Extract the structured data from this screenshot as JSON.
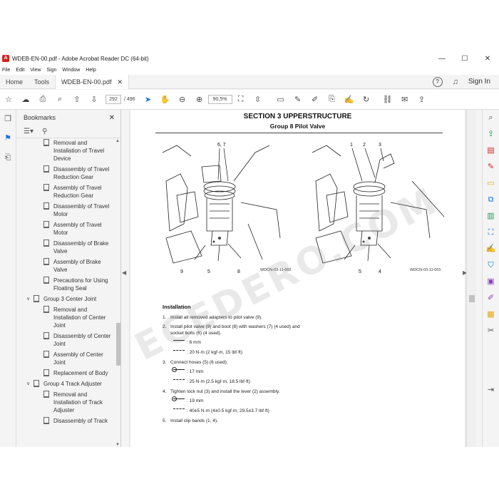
{
  "window": {
    "title": "WDEB-EN-00.pdf - Adobe Acrobat Reader DC (64-bit)",
    "controls": [
      "—",
      "☐",
      "✕"
    ]
  },
  "menu": [
    "File",
    "Edit",
    "View",
    "Sign",
    "Window",
    "Help"
  ],
  "tabs": {
    "home": "Home",
    "tools": "Tools",
    "document": "WDEB-EN-00.pdf",
    "close": "✕",
    "help": "?",
    "signin": "Sign In"
  },
  "toolbar": {
    "current_page": "292",
    "total_pages": "/ 496",
    "zoom": "90,5%"
  },
  "bookmarks": {
    "title": "Bookmarks",
    "items": [
      {
        "label": "Removal and Installation of Travel Device",
        "level": "child"
      },
      {
        "label": "Disassembly of Travel Reduction Gear",
        "level": "child"
      },
      {
        "label": "Assembly of Travel Reduction Gear",
        "level": "child"
      },
      {
        "label": "Disassembly of Travel Motor",
        "level": "child"
      },
      {
        "label": "Assembly of Travel Motor",
        "level": "child"
      },
      {
        "label": "Disassembly of Brake Valve",
        "level": "child"
      },
      {
        "label": "Assembly of Brake Valve",
        "level": "child"
      },
      {
        "label": "Precautions for Using Floating Seal",
        "level": "child"
      },
      {
        "label": "Group 3 Center Joint",
        "level": "group"
      },
      {
        "label": "Removal and Installation of Center Joint",
        "level": "child"
      },
      {
        "label": "Disassembly of Center Joint",
        "level": "child"
      },
      {
        "label": "Assembly of Center Joint",
        "level": "child"
      },
      {
        "label": "Replacement of Body",
        "level": "child"
      },
      {
        "label": "Group 4 Track Adjuster",
        "level": "group"
      },
      {
        "label": "Removal and Installation of Track Adjuster",
        "level": "child"
      },
      {
        "label": "Disassembly of Track",
        "level": "child"
      }
    ]
  },
  "document": {
    "section_title": "SECTION 3 UPPERSTRUCTURE",
    "group_title": "Group 8 Pilot Valve",
    "watermark": "ECEDERO.COM",
    "fig_left": {
      "caption": "WDCN-03-11-002",
      "callouts": [
        "6, 7",
        "9",
        "5",
        "8"
      ]
    },
    "fig_right": {
      "caption": "WDCN-03-11-001",
      "callouts": [
        "1",
        "2",
        "3",
        "5",
        "4"
      ]
    },
    "installation_heading": "Installation",
    "steps": [
      {
        "num": "1.",
        "text": "Install all removed adapters to pilot valve (9).",
        "specs": []
      },
      {
        "num": "2.",
        "text": "Install pilot valve (9) and boot (8) with washers (7) (4 used) and socket bolts (6) (4 used).",
        "specs": [
          {
            "tool": "hex",
            "value": ": 6 mm"
          },
          {
            "tool": "torque",
            "value": ": 20 N·m (2 kgf·m, 15 lbf·ft)"
          }
        ]
      },
      {
        "num": "3.",
        "text": "Connect hoses (5) (6 used).",
        "specs": [
          {
            "tool": "wrench",
            "value": ": 17 mm"
          },
          {
            "tool": "torque",
            "value": ": 25 N·m (2.5 kgf·m, 18.5 lbf·ft)"
          }
        ]
      },
      {
        "num": "4.",
        "text": "Tighten lock nut (3) and install the lever (2) assembly.",
        "specs": [
          {
            "tool": "wrench",
            "value": ": 19 mm"
          },
          {
            "tool": "torque",
            "value": ": 40±5 N·m (4±0.5 kgf·m, 29.5±3.7 lbf·ft)"
          }
        ]
      },
      {
        "num": "5.",
        "text": "Install clip bands (1, 4).",
        "specs": []
      }
    ]
  }
}
